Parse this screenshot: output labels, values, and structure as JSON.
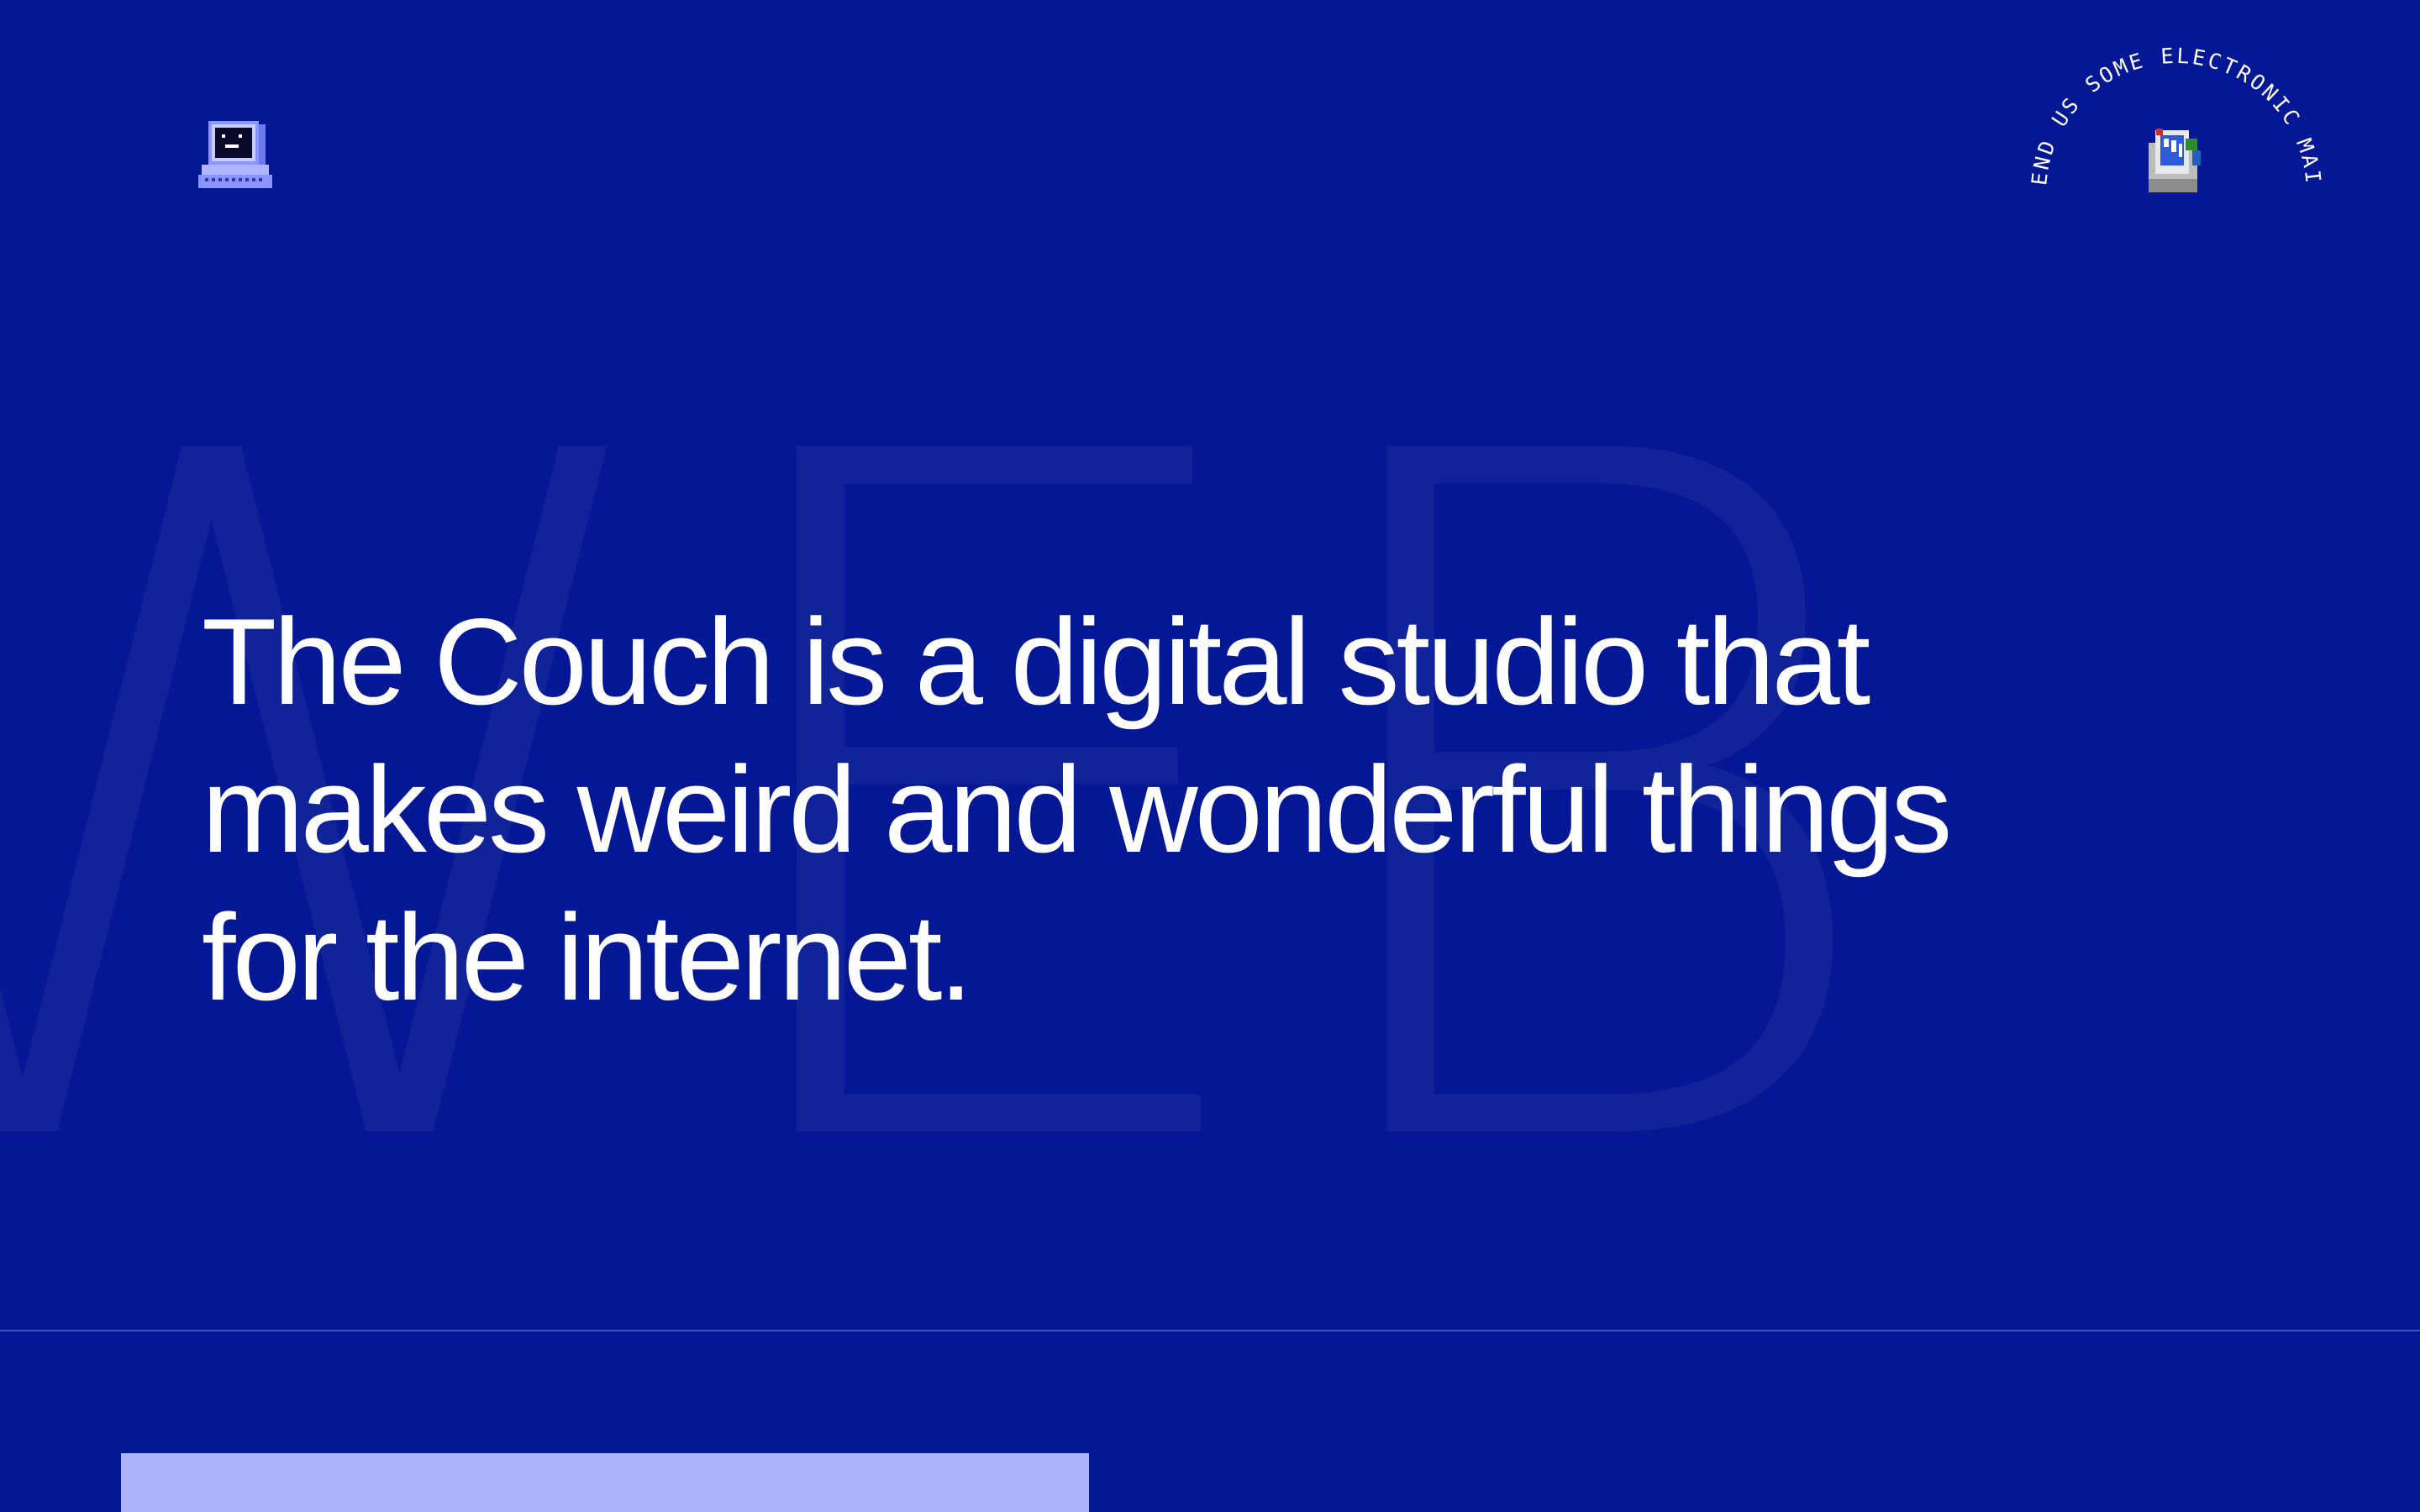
{
  "background_word": "WEB",
  "hero": {
    "lines": [
      "The Couch is a digital studio that",
      "makes weird and wonderful things",
      "for the internet."
    ]
  },
  "header": {
    "logo_icon": "retro-computer-icon",
    "contact": {
      "circular_text": "SEND US SOME ELECTRONIC MAIL",
      "icon": "mail-computer-icon"
    }
  },
  "colors": {
    "background": "#041794",
    "text": "#ffffff",
    "accent_block": "#aeb4fb",
    "background_word": "#1a2a9c"
  }
}
